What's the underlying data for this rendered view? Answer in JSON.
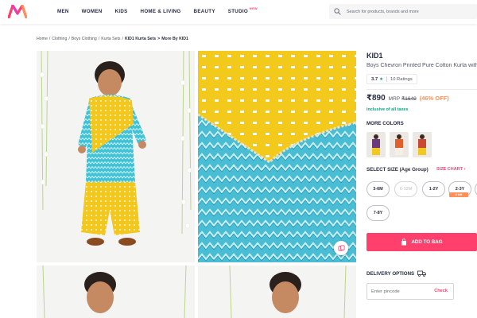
{
  "header": {
    "nav": [
      "MEN",
      "WOMEN",
      "KIDS",
      "HOME & LIVING",
      "BEAUTY",
      "STUDIO"
    ],
    "studio_badge": "NEW",
    "search_placeholder": "Search for products, brands and more",
    "brand_color": "#ff3f6c"
  },
  "breadcrumb": [
    "Home",
    "Clothing",
    "Boys Clothing",
    "Kurta Sets",
    "KID1 Kurta Sets",
    "More By KID1"
  ],
  "gallery": {
    "images": [
      "boy-in-kurta-set-full",
      "fabric-closeup",
      "boy-portrait",
      "boy-portrait-side"
    ],
    "similar_icon": "similar-products-icon"
  },
  "product": {
    "brand": "KID1",
    "name": "Boys Chevron Printed Pure Cotton Kurta with Dhoti Pants",
    "rating": "3.7",
    "rating_count": "10 Ratings",
    "price": "₹890",
    "mrp_label": "MRP",
    "mrp": "₹1649",
    "discount": "(46% OFF)",
    "tax_note": "inclusive of all taxes",
    "more_colors_title": "MORE COLORS",
    "color_swatches": [
      "#6a3b78",
      "#e0602b",
      "#c9482f"
    ],
    "size_title": "SELECT SIZE (Age Group)",
    "size_chart": "SIZE CHART",
    "sizes": [
      {
        "label": "3-6M",
        "available": true
      },
      {
        "label": "6-12M",
        "available": false
      },
      {
        "label": "1-2Y",
        "available": true
      },
      {
        "label": "2-3Y",
        "available": true
      },
      {
        "label": "7-8Y",
        "available": true
      }
    ],
    "left_badge": "3 left",
    "add_to_bag": "ADD TO BAG",
    "delivery_title": "DELIVERY OPTIONS",
    "pincode_placeholder": "Enter pincode",
    "check": "Check"
  }
}
